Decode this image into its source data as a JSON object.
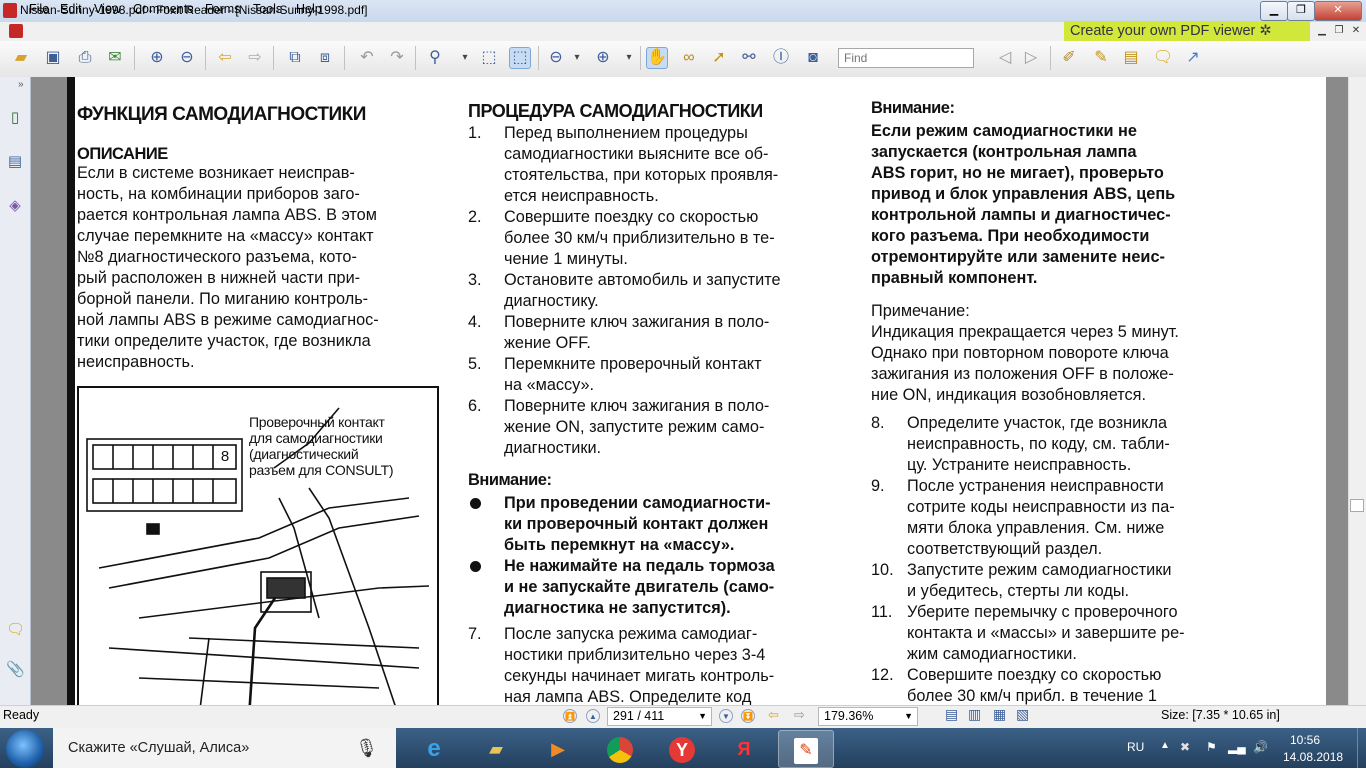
{
  "window": {
    "title": "Nissan-Sunny-1998.pdf - Foxit Reader - [Nissan-Sunny-1998.pdf]"
  },
  "menu": [
    "File",
    "Edit",
    "View",
    "Comments",
    "Forms",
    "Tools",
    "Help"
  ],
  "promo": "Create your own PDF viewer",
  "find": {
    "placeholder": "Find"
  },
  "doc": {
    "left": {
      "title": "ФУНКЦИЯ САМОДИАГНОСТИКИ",
      "subtitle": "ОПИСАНИЕ",
      "lines": [
        "Если в системе возникает неисправ-",
        "ность, на комбинации приборов заго-",
        "рается контрольная лампа ABS. В этом",
        "случае перемкните на «массу» контакт",
        "№8 диагностического разъема, кото-",
        "рый расположен в нижней части при-",
        "борной панели. По миганию контроль-",
        "ной лампы ABS в режиме самодиагнос-",
        "тики определите участок, где возникла",
        "неисправность."
      ],
      "figure_label": [
        "Проверочный контакт",
        "для самодиагностики",
        "(диагностический",
        "разъем для CONSULT)"
      ],
      "pin_label": "8"
    },
    "mid": {
      "title": "ПРОЦЕДУРА САМОДИАГНОСТИКИ",
      "steps": [
        {
          "n": "1.",
          "lines": [
            "Перед выполнением процедуры",
            "самодиагностики выясните все об-",
            "стоятельства, при которых проявля-",
            "ется неисправность."
          ]
        },
        {
          "n": "2.",
          "lines": [
            "Совершите поездку со скоростью",
            "более 30 км/ч приблизительно в те-",
            "чение 1 минуты."
          ]
        },
        {
          "n": "3.",
          "lines": [
            "Остановите автомобиль и запустите",
            "диагностику."
          ]
        },
        {
          "n": "4.",
          "lines": [
            "Поверните ключ зажигания в поло-",
            "жение OFF."
          ]
        },
        {
          "n": "5.",
          "lines": [
            "Перемкните проверочный контакт",
            "на «массу»."
          ]
        },
        {
          "n": "6.",
          "lines": [
            "Поверните ключ зажигания в поло-",
            "жение ON, запустите режим само-",
            "диагностики."
          ]
        }
      ],
      "warning_title": "Внимание:",
      "warnings": [
        [
          "При проведении самодиагности-",
          "ки проверочный контакт должен",
          "быть перемкнут на «массу»."
        ],
        [
          "Не нажимайте на педаль тормоза",
          "и не запускайте двигатель (само-",
          "диагностика не запустится)."
        ]
      ],
      "step7": {
        "n": "7.",
        "lines": [
          "После запуска режима самодиаг-",
          "ностики приблизительно через 3-4",
          "секунды начинает мигать контроль-",
          "ная лампа ABS. Определите код"
        ]
      }
    },
    "right": {
      "warning_title": "Внимание:",
      "warning_lines": [
        "Если режим самодиагностики не",
        "запускается (контрольная лампа",
        "ABS горит, но не мигает), проверьто",
        "привод и блок управления ABS, цепь",
        "контрольной лампы и диагностичес-",
        "кого разъема. При необходимости",
        "отремонтируйте или замените неис-",
        "правный компонент."
      ],
      "note_title": "Примечание:",
      "note_lines": [
        "Индикация прекращается через 5 минут.",
        "Однако при повторном повороте ключа",
        "зажигания из положения OFF в положе-",
        "ние ON, индикация возобновляется."
      ],
      "steps": [
        {
          "n": "8.",
          "lines": [
            "Определите участок, где возникла",
            "неисправность, по коду, см. табли-",
            "цу. Устраните неисправность."
          ]
        },
        {
          "n": "9.",
          "lines": [
            "После устранения неисправности",
            "сотрите коды неисправности из па-",
            "мяти блока управления. См. ниже",
            "соответствующий раздел."
          ]
        },
        {
          "n": "10.",
          "lines": [
            "Запустите режим самодиагностики",
            "и убедитесь, стерты ли коды."
          ]
        },
        {
          "n": "11.",
          "lines": [
            "Уберите перемычку с проверочного",
            "контакта и «массы» и завершите ре-",
            "жим самодиагностики."
          ]
        },
        {
          "n": "12.",
          "lines": [
            "Совершите поездку со скоростью",
            "более 30 км/ч прибл. в течение 1"
          ]
        }
      ]
    }
  },
  "status": {
    "ready": "Ready",
    "page": "291 / 411",
    "zoom": "179.36%",
    "size": "Size: [7.35 * 10.65 in]"
  },
  "taskbar": {
    "alice": "Скажите «Слушай, Алиса»",
    "lang": "RU",
    "time": "10:56",
    "date": "14.08.2018"
  }
}
